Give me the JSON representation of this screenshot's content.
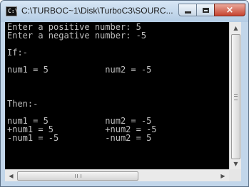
{
  "window": {
    "title": "C:\\TURBOC~1\\Disk\\TurboC3\\SOURC...",
    "icon": "console-app-icon",
    "icon_glyph": "C:\\",
    "caption_buttons": {
      "minimize": "minimize-icon",
      "maximize": "maximize-icon",
      "close": "×"
    }
  },
  "console": {
    "lines": [
      "Enter a positive number: 5",
      "Enter a negative number: -5",
      "",
      "If:-",
      "",
      "num1 = 5           num2 = -5",
      "",
      "",
      "",
      "Then:-",
      "",
      "num1 = 5           num2 = -5",
      "+num1 = 5          +num2 = -5",
      "-num1 = -5         -num2 = 5"
    ]
  },
  "scrollbars": {
    "up_arrow": "▲",
    "down_arrow": "▼",
    "left_arrow": "◀",
    "right_arrow": "▶"
  }
}
